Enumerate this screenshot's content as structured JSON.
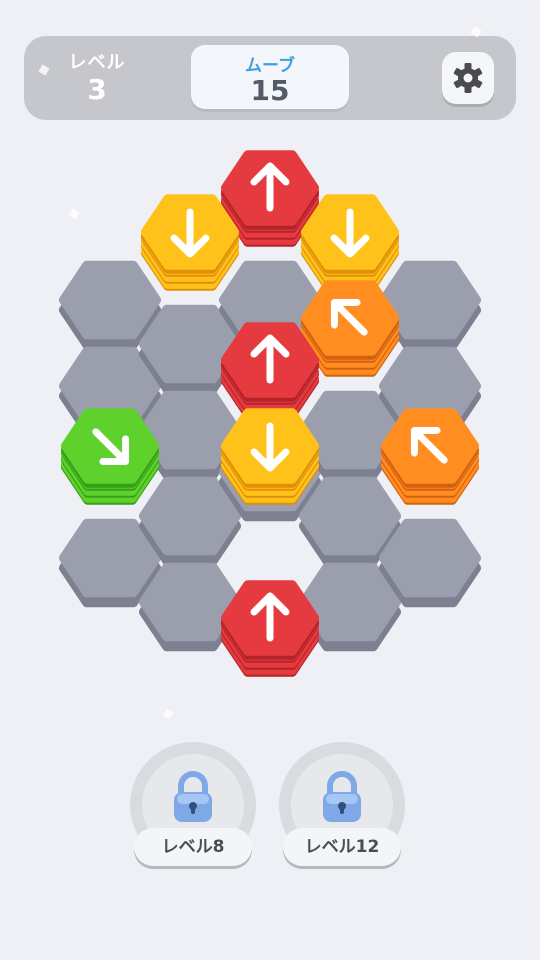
{
  "hud": {
    "level_label": "レベル",
    "level_value": "3",
    "moves_label": "ムーブ",
    "moves_value": "15"
  },
  "board": {
    "empty_cells": [
      [
        1,
        2
      ],
      [
        1,
        3
      ],
      [
        1,
        4
      ],
      [
        1,
        5
      ],
      [
        2,
        2
      ],
      [
        2,
        3
      ],
      [
        2,
        5
      ],
      [
        2,
        6
      ],
      [
        3,
        2
      ],
      [
        3,
        3
      ],
      [
        3,
        4
      ],
      [
        3,
        5
      ],
      [
        4,
        4
      ],
      [
        5,
        2
      ],
      [
        5,
        3
      ],
      [
        5,
        4
      ],
      [
        5,
        5
      ],
      [
        0,
        4
      ],
      [
        0,
        5
      ],
      [
        0,
        6
      ],
      [
        6,
        0
      ]
    ],
    "tiles": [
      {
        "color": "red",
        "arrow": "up",
        "layers": 4
      },
      {
        "color": "yellow",
        "arrow": "down",
        "layers": 4
      },
      {
        "color": "yellow",
        "arrow": "down",
        "layers": 4
      },
      {
        "color": "orange",
        "arrow": "up-left",
        "layers": 4
      },
      {
        "color": "red",
        "arrow": "up",
        "layers": 4
      },
      {
        "color": "green",
        "arrow": "down-right",
        "layers": 4
      },
      {
        "color": "yellow",
        "arrow": "down",
        "layers": 4
      },
      {
        "color": "orange",
        "arrow": "up-left",
        "layers": 4
      },
      {
        "color": "red",
        "arrow": "up",
        "layers": 4
      }
    ],
    "colors": {
      "cell_top": "#9b9fad",
      "cell_side": "#7c8090",
      "red": "#e53a3f",
      "red_dark": "#b5232a",
      "yellow": "#ffc21a",
      "yellow_dark": "#e08f06",
      "orange": "#ff8d1f",
      "orange_dark": "#d4610e",
      "green": "#5fd12c",
      "green_dark": "#35a115"
    }
  },
  "locks": [
    {
      "label": "レベル8",
      "icon": "padlock-icon"
    },
    {
      "label": "レベル12",
      "icon": "padlock-icon"
    }
  ],
  "settings": {
    "icon": "gear-icon"
  }
}
